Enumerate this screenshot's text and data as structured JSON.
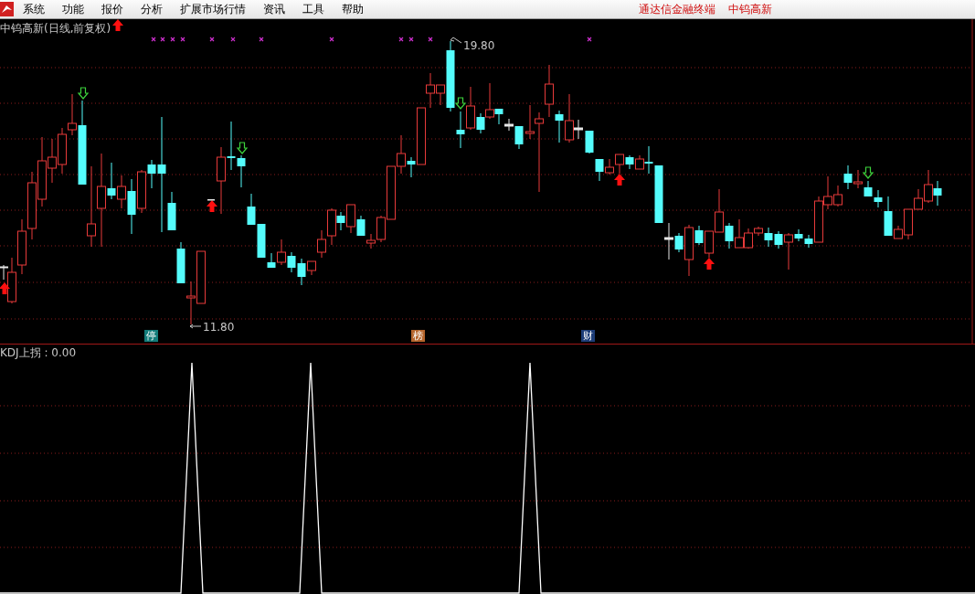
{
  "menu": {
    "items": [
      {
        "label": "系统"
      },
      {
        "label": "功能"
      },
      {
        "label": "报价"
      },
      {
        "label": "分析"
      },
      {
        "label": "扩展市场行情"
      },
      {
        "label": "资讯"
      },
      {
        "label": "工具"
      },
      {
        "label": "帮助"
      }
    ],
    "right_texts": [
      "通达信金融终端",
      "中钨高新"
    ]
  },
  "price_chart": {
    "title": "中钨高新(日线,前复权)",
    "high_label": "19.80",
    "low_label": "11.80",
    "markers": [
      {
        "text": "停",
        "color": "#127c7a"
      },
      {
        "text": "榜",
        "color": "#b5652c"
      },
      {
        "text": "财",
        "color": "#1d3d78"
      }
    ]
  },
  "indicator": {
    "label": "KDJ上拐 : 0.00"
  }
}
